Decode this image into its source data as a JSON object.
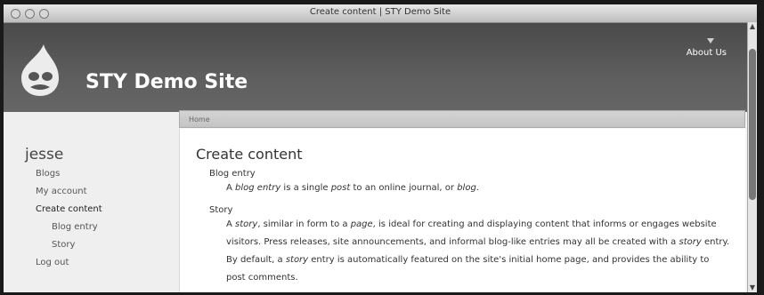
{
  "window": {
    "title": "Create content | STY Demo Site"
  },
  "site": {
    "name": "STY Demo Site",
    "logo_icon": "drupal-drop-logo"
  },
  "header": {
    "about_link": "About Us"
  },
  "sidebar": {
    "username": "jesse",
    "items": [
      {
        "label": "Blogs",
        "active": false,
        "sub": false
      },
      {
        "label": "My account",
        "active": false,
        "sub": false
      },
      {
        "label": "Create content",
        "active": true,
        "sub": false
      },
      {
        "label": "Blog entry",
        "active": false,
        "sub": true
      },
      {
        "label": "Story",
        "active": false,
        "sub": true
      },
      {
        "label": "Log out",
        "active": false,
        "sub": false
      }
    ]
  },
  "breadcrumb": {
    "home": "Home"
  },
  "main": {
    "title": "Create content",
    "entries": [
      {
        "term": "Blog entry",
        "desc": {
          "p1": "A ",
          "e1": "blog entry",
          "p2": " is a single ",
          "e2": "post",
          "p3": " to an online journal, or ",
          "e3": "blog",
          "p4": "."
        }
      },
      {
        "term": "Story",
        "desc": {
          "p1": "A ",
          "e1": "story",
          "p2": ", similar in form to a ",
          "e2": "page",
          "p3": ", is ideal for creating and displaying content that informs or engages website visitors. Press releases, site announcements, and informal blog-like entries may all be created with a ",
          "e3": "story",
          "p4": " entry. By default, a ",
          "e4": "story",
          "p5": " entry is automatically featured on the site's initial home page, and provides the ability to post comments."
        }
      }
    ]
  }
}
